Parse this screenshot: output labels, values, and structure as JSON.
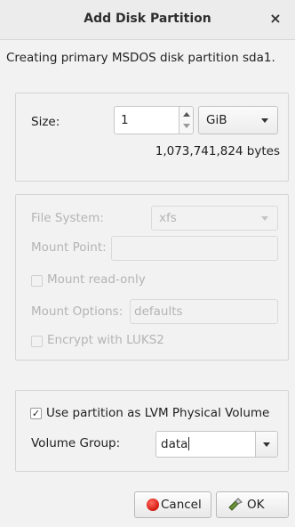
{
  "window": {
    "title": "Add Disk Partition",
    "close_glyph": "×"
  },
  "subtitle": "Creating primary MSDOS disk partition sda1.",
  "size": {
    "label": "Size:",
    "value": "1",
    "unit": "GiB",
    "bytes": "1,073,741,824 bytes"
  },
  "filesystem": {
    "fs_label": "File System:",
    "fs_value": "xfs",
    "mount_point_label": "Mount Point:",
    "mount_point_value": "",
    "read_only_label": "Mount read-only",
    "read_only_checked": false,
    "mount_options_label": "Mount Options:",
    "mount_options_value": "defaults",
    "encrypt_label": "Encrypt with LUKS2",
    "encrypt_checked": false,
    "enabled": false
  },
  "lvm": {
    "use_lvm_label": "Use partition as LVM Physical Volume",
    "use_lvm_checked": true,
    "check_glyph": "✓",
    "volume_group_label": "Volume Group:",
    "volume_group_value": "data"
  },
  "buttons": {
    "cancel": "Cancel",
    "ok": "OK"
  },
  "icons": {
    "close": "close-icon",
    "spinner_up": "spin-up-icon",
    "spinner_down": "spin-down-icon",
    "dropdown": "chevron-down-icon",
    "cancel": "cancel-icon",
    "ok": "ok-icon"
  },
  "colors": {
    "window_bg": "#f2f2f2",
    "disabled_text": "#b4b4b4",
    "cancel_red": "#d41a10"
  }
}
